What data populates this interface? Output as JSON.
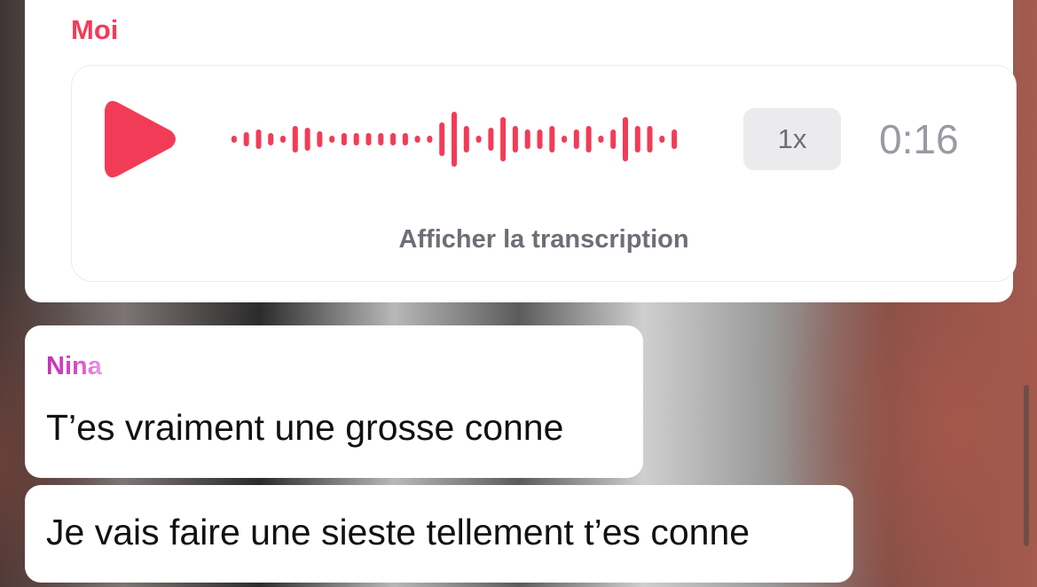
{
  "messages": {
    "moi": {
      "sender": "Moi",
      "voice_note": {
        "speed": "1x",
        "duration": "0:16",
        "transcript_label": "Afficher la transcription",
        "accent_color": "#f23c57"
      }
    },
    "nina": {
      "sender": "Nina",
      "texts": [
        "T’es vraiment une grosse conne",
        "Je vais faire une sieste tellement t’es conne"
      ],
      "accent_color": "#d84ac7"
    }
  },
  "icons": {
    "play": "play-icon"
  }
}
